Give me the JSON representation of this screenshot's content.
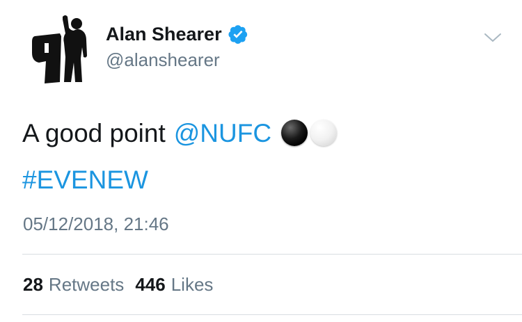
{
  "user": {
    "display_name": "Alan Shearer",
    "handle": "@alanshearer",
    "verified_icon": "verified-badge-icon",
    "avatar_icon": "number-9-celebration-logo"
  },
  "tweet": {
    "text_plain": "A good point",
    "mention": "@NUFC",
    "emoji": [
      "black-circle",
      "white-circle"
    ],
    "hashtag": "#EVENEW",
    "timestamp": "05/12/2018, 21:46"
  },
  "stats": {
    "retweets_count": "28",
    "retweets_label": "Retweets",
    "likes_count": "446",
    "likes_label": "Likes"
  },
  "colors": {
    "link": "#1b95e0",
    "text": "#14171a",
    "secondary": "#657786",
    "verified": "#1da1f2",
    "divider": "#d8dde1"
  }
}
